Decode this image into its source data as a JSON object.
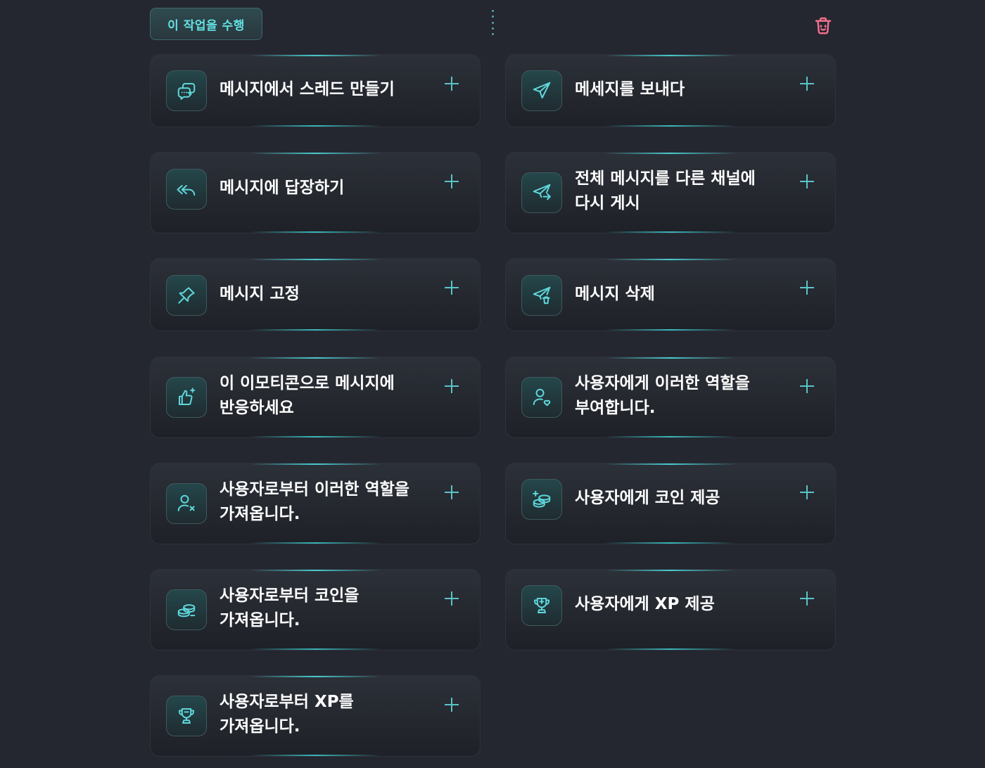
{
  "toolbar": {
    "action_label": "이 작업을 수행"
  },
  "colors": {
    "accent": "#59c4c8",
    "accent_text": "#63e0e3",
    "danger": "#ef6f8a",
    "background": "#242630"
  },
  "actions": [
    {
      "label": "메시지에서 스레드 만들기",
      "icon": "chat-bubbles-icon"
    },
    {
      "label": "메세지를 보내다",
      "icon": "paper-plane-icon"
    },
    {
      "label": "메시지에 답장하기",
      "icon": "reply-all-icon"
    },
    {
      "label": "전체 메시지를 다른 채널에 다시 게시",
      "icon": "paper-plane-forward-icon"
    },
    {
      "label": "메시지 고정",
      "icon": "pin-icon"
    },
    {
      "label": "메시지 삭제",
      "icon": "paper-plane-trash-icon"
    },
    {
      "label": "이 이모티콘으로 메시지에 반응하세요",
      "icon": "thumbs-up-sparkle-icon"
    },
    {
      "label": "사용자에게 이러한 역할을 부여합니다.",
      "icon": "user-heart-icon"
    },
    {
      "label": "사용자로부터 이러한 역할을 가져옵니다.",
      "icon": "user-remove-icon"
    },
    {
      "label": "사용자에게 코인 제공",
      "icon": "coins-plus-icon"
    },
    {
      "label": "사용자로부터 코인을 가져옵니다.",
      "icon": "coins-minus-icon"
    },
    {
      "label": "사용자에게 XP 제공",
      "icon": "trophy-plus-icon"
    },
    {
      "label": "사용자로부터 XP를 가져옵니다.",
      "icon": "trophy-minus-icon"
    }
  ]
}
